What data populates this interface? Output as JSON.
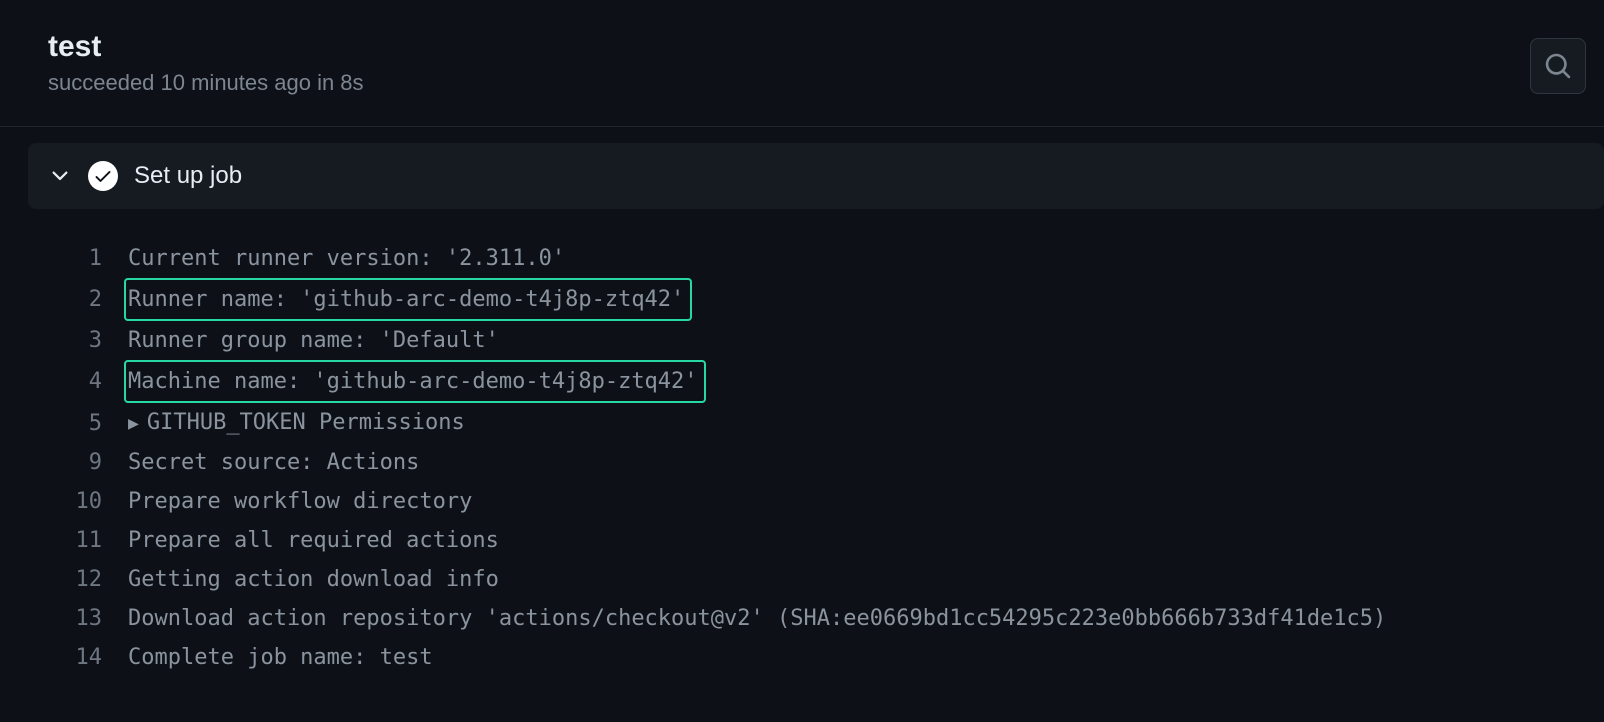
{
  "header": {
    "title": "test",
    "status": "succeeded 10 minutes ago in 8s"
  },
  "step": {
    "title": "Set up job"
  },
  "log": {
    "lines": [
      {
        "num": "1",
        "text": "Current runner version: '2.311.0'",
        "highlighted": false,
        "expandable": false
      },
      {
        "num": "2",
        "text": "Runner name: 'github-arc-demo-t4j8p-ztq42'",
        "highlighted": true,
        "expandable": false
      },
      {
        "num": "3",
        "text": "Runner group name: 'Default'",
        "highlighted": false,
        "expandable": false
      },
      {
        "num": "4",
        "text": "Machine name: 'github-arc-demo-t4j8p-ztq42'",
        "highlighted": true,
        "expandable": false
      },
      {
        "num": "5",
        "text": "GITHUB_TOKEN Permissions",
        "highlighted": false,
        "expandable": true
      },
      {
        "num": "9",
        "text": "Secret source: Actions",
        "highlighted": false,
        "expandable": false
      },
      {
        "num": "10",
        "text": "Prepare workflow directory",
        "highlighted": false,
        "expandable": false
      },
      {
        "num": "11",
        "text": "Prepare all required actions",
        "highlighted": false,
        "expandable": false
      },
      {
        "num": "12",
        "text": "Getting action download info",
        "highlighted": false,
        "expandable": false
      },
      {
        "num": "13",
        "text": "Download action repository 'actions/checkout@v2' (SHA:ee0669bd1cc54295c223e0bb666b733df41de1c5)",
        "highlighted": false,
        "expandable": false
      },
      {
        "num": "14",
        "text": "Complete job name: test",
        "highlighted": false,
        "expandable": false
      }
    ]
  }
}
